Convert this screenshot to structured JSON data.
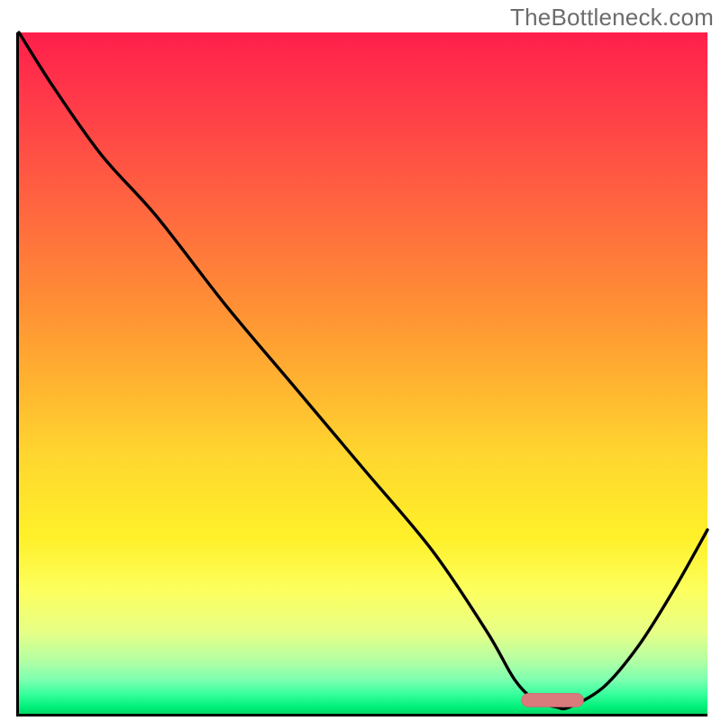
{
  "watermark": "TheBottleneck.com",
  "chart_data": {
    "type": "line",
    "title": "",
    "xlabel": "",
    "ylabel": "",
    "xlim": [
      0,
      100
    ],
    "ylim": [
      0,
      100
    ],
    "grid": false,
    "legend": false,
    "note": "Bottleneck chart: x is component ratio, y is bottleneck % (0 = ideal). Background is a red→green vertical heatmap; curve shows bottleneck level vs ratio; pink pill marks the optimal balance zone.",
    "series": [
      {
        "name": "bottleneck-curve",
        "x": [
          0,
          5,
          12,
          20,
          30,
          40,
          50,
          60,
          68,
          72,
          75,
          78,
          80,
          85,
          90,
          95,
          100
        ],
        "y": [
          100,
          92,
          82,
          73,
          60,
          48,
          36,
          24,
          12,
          5,
          2,
          1,
          1,
          4,
          10,
          18,
          27
        ]
      }
    ],
    "optimal_zone": {
      "x_start": 73,
      "x_end": 82,
      "y": 2
    },
    "background": {
      "type": "vertical_gradient",
      "stops": [
        {
          "pct": 0,
          "color": "#ff1f4b"
        },
        {
          "pct": 40,
          "color": "#ff8f35"
        },
        {
          "pct": 74,
          "color": "#fff029"
        },
        {
          "pct": 95,
          "color": "#7dffb0"
        },
        {
          "pct": 100,
          "color": "#00d866"
        }
      ]
    }
  }
}
